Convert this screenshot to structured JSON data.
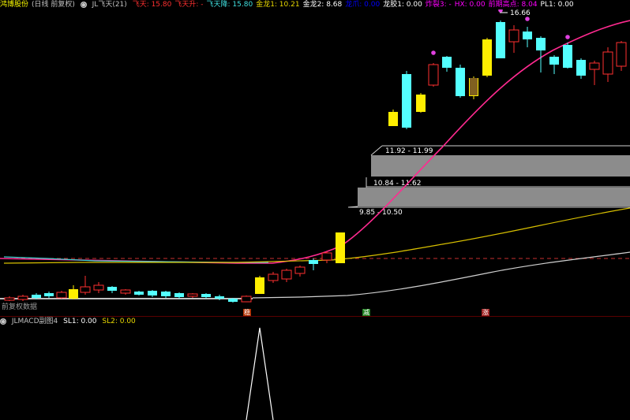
{
  "header": {
    "stock_title": "鸿博股份",
    "period": "(日线 前复权)",
    "indicator_name": "JL飞天(21)",
    "items": [
      {
        "label": "飞天: 15.80",
        "color": "#ff3030"
      },
      {
        "label": "飞天升: -",
        "color": "#ff3030"
      },
      {
        "label": "飞天降: 15.80",
        "color": "#40e0e0"
      },
      {
        "label": "金龙1: 10.21",
        "color": "#e8d800"
      },
      {
        "label": "金龙2: 8.68",
        "color": "#ffffff"
      },
      {
        "label": "龙爪: 0.00",
        "color": "#0000ff"
      },
      {
        "label": "龙胶1: 0.00",
        "color": "#ffffff"
      },
      {
        "label": "炸裂3: -",
        "color": "#ff00ff"
      },
      {
        "label": "HX: 0.00",
        "color": "#ff00ff"
      },
      {
        "label": "前期高点: 8.04",
        "color": "#ff00ff"
      },
      {
        "label": "PL1: 0.00",
        "color": "#ffffff"
      }
    ]
  },
  "price_labels": {
    "peak": "16.66",
    "zone1": "11.92 - 11.99",
    "zone2": "10.84 - 11.62",
    "zone3": "9.85 - 10.50"
  },
  "left_label": "前复权数据",
  "signal_tags": [
    {
      "text": "稳",
      "color": "#b03000"
    },
    {
      "text": "减",
      "color": "#208020"
    },
    {
      "text": "涨",
      "color": "#a02020"
    }
  ],
  "sub_header": {
    "name": "JLMACD副图4",
    "sl1": "SL1: 0.00",
    "sl2": "SL2: 0.00",
    "sl1_color": "#ffffff",
    "sl2_color": "#e8d800"
  },
  "chart_data": {
    "type": "candlestick",
    "peak_price": 16.66,
    "zones": [
      {
        "low": 11.92,
        "high": 11.99
      },
      {
        "low": 10.84,
        "high": 11.62
      },
      {
        "low": 9.85,
        "high": 10.5
      }
    ],
    "previous_high": 8.04,
    "series_colors": {
      "up": "#ff3030",
      "down": "#54ffff",
      "yellow": "#ffee00",
      "ma_pink": "#ff2a90",
      "ma_yellow": "#d8c000",
      "ma_white": "#d0d0d0"
    }
  }
}
